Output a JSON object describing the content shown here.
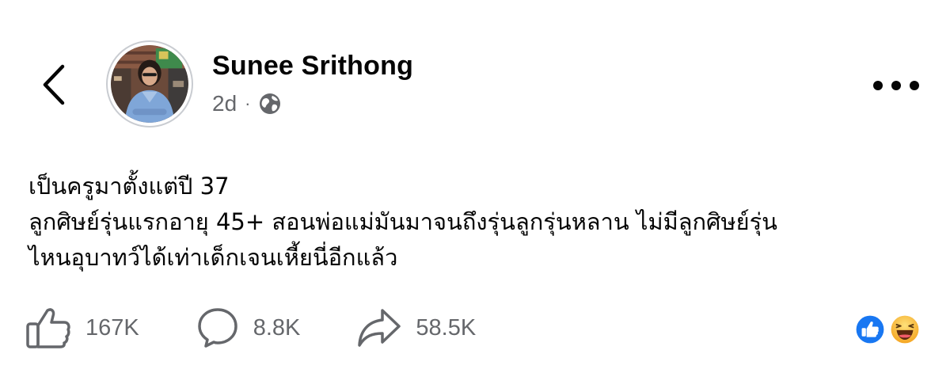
{
  "author": {
    "name": "Sunee Srithong",
    "avatar_icon": "profile-photo"
  },
  "meta": {
    "time": "2d",
    "separator": "·",
    "audience_icon": "globe-icon"
  },
  "post": {
    "lines": [
      "เป็นครูมาตั้งแต่ปี 37",
      "ลูกศิษย์รุ่นแรกอายุ 45+ สอนพ่อแม่มันมาจนถึงรุ่นลูกรุ่นหลาน ไม่มีลูกศิษย์รุ่น",
      "ไหนอุบาทว์ได้เท่าเด็กเจนเหี้ยนี่อีกแล้ว"
    ]
  },
  "actions": {
    "likes": "167K",
    "comments": "8.8K",
    "shares": "58.5K"
  },
  "reactions": [
    "like-reaction",
    "haha-reaction"
  ],
  "colors": {
    "text": "#050505",
    "secondary": "#65676b",
    "like_blue": "#1877f2",
    "haha_yellow": "#f7b125"
  }
}
